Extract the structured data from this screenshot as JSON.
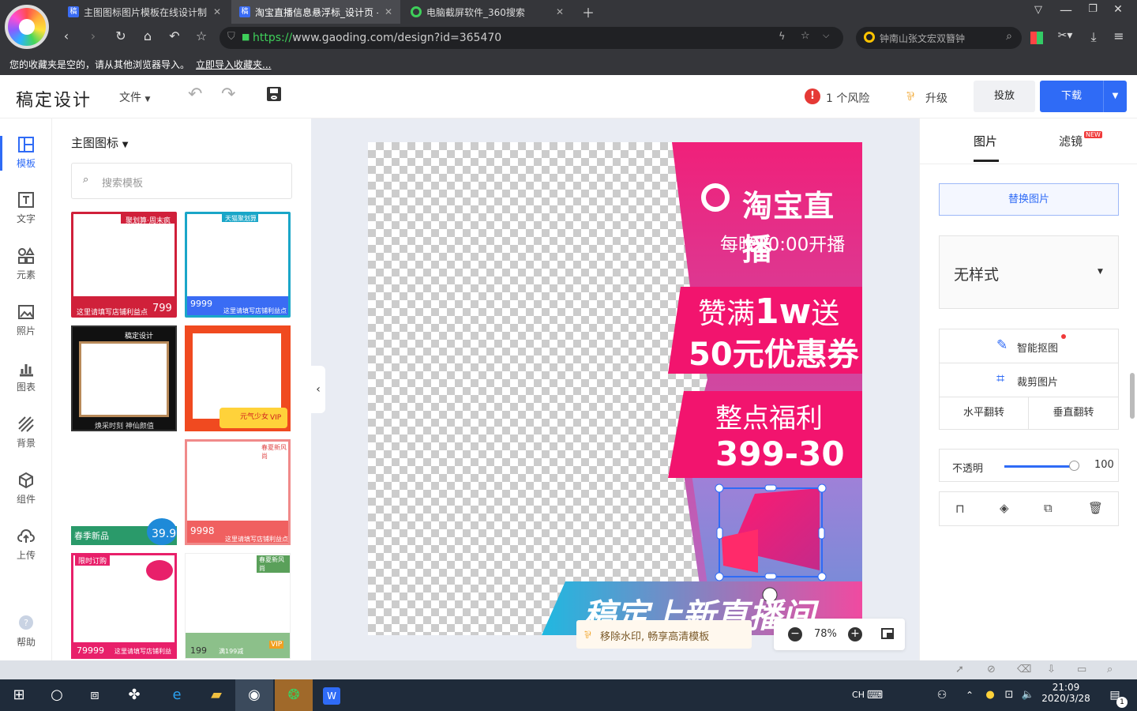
{
  "browser": {
    "tabs": [
      {
        "title": "主图图标图片模板在线设计制",
        "active": false
      },
      {
        "title": "淘宝直播信息悬浮标_设计页 -",
        "active": true
      },
      {
        "title": "电脑截屏软件_360搜索",
        "active": false
      }
    ],
    "url_scheme": "https://",
    "url_rest": "www.gaoding.com/design?id=365470",
    "search_text": "钟南山张文宏双簪钟",
    "bookmark_text": "您的收藏夹是空的，请从其他浏览器导入。",
    "bookmark_link": "立即导入收藏夹..."
  },
  "header": {
    "brand": "稿定设计",
    "file_menu": "文件",
    "risk": "1 个风险",
    "upgrade": "升级",
    "cast": "投放",
    "download": "下载"
  },
  "leftnav": [
    {
      "label": "模板",
      "icon": "template-icon"
    },
    {
      "label": "文字",
      "icon": "text-icon"
    },
    {
      "label": "元素",
      "icon": "elements-icon"
    },
    {
      "label": "照片",
      "icon": "photo-icon"
    },
    {
      "label": "图表",
      "icon": "chart-icon"
    },
    {
      "label": "背景",
      "icon": "background-icon"
    },
    {
      "label": "组件",
      "icon": "component-icon"
    },
    {
      "label": "上传",
      "icon": "upload-icon"
    },
    {
      "label": "帮助",
      "icon": "help-icon"
    }
  ],
  "panel": {
    "title": "主图图标",
    "search_placeholder": "搜索模板",
    "thumbs": [
      {
        "top": "聚划算·周末疯抢",
        "bottom": "这里请填写店铺利益点",
        "price": "799"
      },
      {
        "top": "天猫聚划算",
        "bottom": "这里请填写店铺利益点",
        "price": "9999"
      },
      {
        "top": "稿定设计",
        "bottom": "焕采时刻 神仙颜值",
        "price": ""
      },
      {
        "top": "",
        "bottom": "元气少女",
        "price": "VIP"
      },
      {
        "top": "",
        "bottom": "春季新品",
        "price": "39.9"
      },
      {
        "top": "春夏新风尚",
        "bottom": "这里请填写店铺利益点",
        "price": "9998"
      },
      {
        "top": "限时订购",
        "bottom": "这里请填写店铺利益点",
        "price": "79999"
      },
      {
        "top": "春夏新风尚",
        "bottom": "满199减",
        "price": "199"
      }
    ]
  },
  "artwork": {
    "brand": "淘宝直播",
    "schedule": "每晚20:00开播",
    "promo1_a": "赞满",
    "promo1_b": "1w",
    "promo1_c": "送",
    "promo2": "50元优惠券",
    "promo3": "整点福利",
    "promo4": "399-30",
    "footer": "稿定上新直播间"
  },
  "canvas": {
    "watermark": "移除水印, 畅享高清模板",
    "zoom": "78%"
  },
  "rpanel": {
    "tab_image": "图片",
    "tab_filter": "滤镜",
    "new_badge": "NEW",
    "replace": "替换图片",
    "style": "无样式",
    "smart_cutout": "智能抠图",
    "crop": "裁剪图片",
    "flip_h": "水平翻转",
    "flip_v": "垂直翻转",
    "opacity_label": "不透明",
    "opacity_value": "100"
  },
  "taskbar": {
    "time": "21:09",
    "date": "2020/3/28",
    "ime": "CH",
    "notif": "1"
  },
  "colors": {
    "accent": "#2f6bf6",
    "pink": "#f2146e"
  }
}
